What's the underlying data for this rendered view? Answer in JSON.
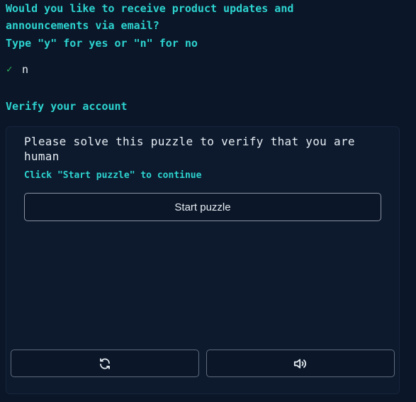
{
  "prompt": {
    "question_line1": "Would you like to receive product updates and",
    "question_line2": "announcements via email?",
    "instruction": "Type \"y\" for yes or \"n\" for no",
    "answer_check": "✓",
    "answer_value": "n"
  },
  "verify": {
    "heading": "Verify your account"
  },
  "puzzle": {
    "text": "Please solve this puzzle to verify that you are human",
    "hint": "Click \"Start puzzle\" to continue",
    "start_label": "Start puzzle",
    "reload_icon": "reload-icon",
    "audio_icon": "audio-icon"
  },
  "colors": {
    "background": "#0b1628",
    "accent": "#2dd4d0",
    "check": "#2fbf5f"
  }
}
